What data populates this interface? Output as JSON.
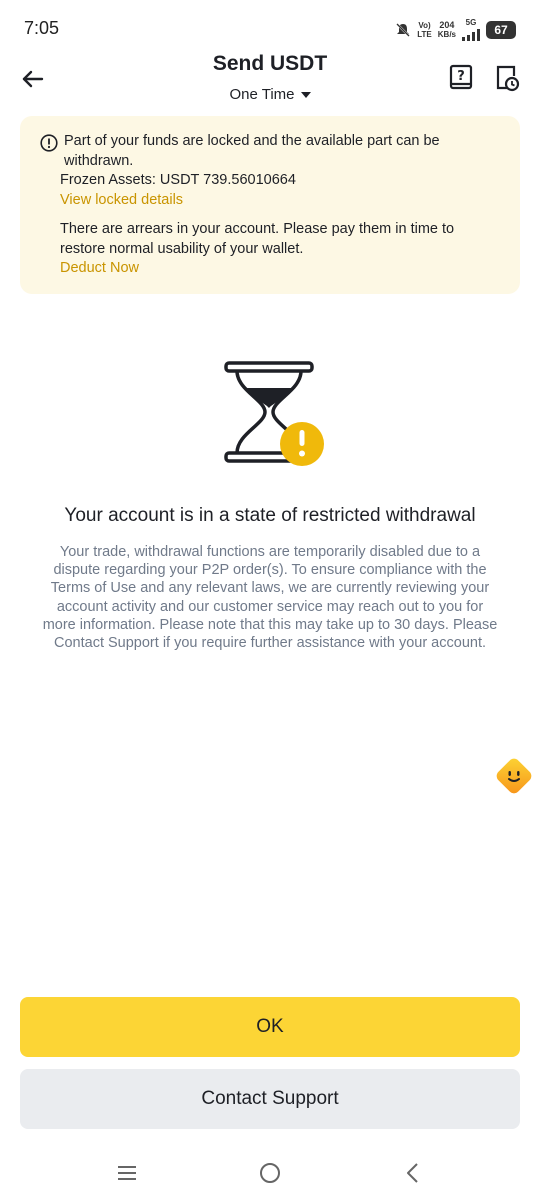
{
  "status_bar": {
    "time": "7:05",
    "volte_top": "Vo)",
    "volte_bottom": "LTE",
    "speed_value": "204",
    "speed_unit": "KB/s",
    "network": "5G",
    "battery": "67"
  },
  "header": {
    "title": "Send USDT",
    "subtitle": "One Time"
  },
  "notice": {
    "line1": "Part of your funds are locked and the available part can be withdrawn.",
    "frozen_assets": "Frozen Assets: USDT 739.56010664",
    "view_locked_link": "View locked details",
    "arrears_text": "There are arrears in your account. Please pay them in time to restore normal usability of your wallet.",
    "deduct_link": "Deduct Now"
  },
  "main": {
    "headline": "Your account is in a state of restricted withdrawal",
    "body": "Your trade, withdrawal functions are temporarily disabled due to a dispute regarding your P2P order(s). To ensure compliance with the Terms of Use and any relevant laws, we are currently reviewing your account activity and our customer service may reach out to you for more information. Please note that this may take up to 30 days. Please Contact Support if you require further assistance with your account."
  },
  "buttons": {
    "ok": "OK",
    "contact_support": "Contact Support"
  },
  "colors": {
    "accent_yellow": "#fcd535",
    "link_gold": "#c99400",
    "notice_bg": "#fdf8e4",
    "secondary_button": "#eaecef",
    "body_grey": "#707a8a"
  },
  "icons": [
    "back-arrow-icon",
    "help-book-icon",
    "order-history-icon",
    "info-circle-icon",
    "hourglass-warning-icon",
    "assistant-icon",
    "menu-icon",
    "home-icon",
    "back-nav-icon"
  ]
}
